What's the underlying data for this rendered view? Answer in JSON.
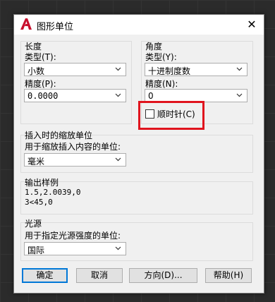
{
  "dialog": {
    "title": "图形单位",
    "close_glyph": "✕"
  },
  "length": {
    "group_label": "长度",
    "type_label": "类型(T):",
    "type_value": "小数",
    "precision_label": "精度(P):",
    "precision_value": "0.0000"
  },
  "angle": {
    "group_label": "角度",
    "type_label": "类型(Y):",
    "type_value": "十进制度数",
    "precision_label": "精度(N):",
    "precision_value": "0",
    "clockwise_label": "顺时针(C)",
    "clockwise_checked": false
  },
  "insertion": {
    "group_label": "插入时的缩放单位",
    "units_label": "用于缩放插入内容的单位:",
    "units_value": "毫米"
  },
  "sample": {
    "group_label": "输出样例",
    "line1": "1.5,2.0039,0",
    "line2": "3<45,0"
  },
  "lighting": {
    "group_label": "光源",
    "units_label": "用于指定光源强度的单位:",
    "units_value": "国际"
  },
  "buttons": {
    "ok": "确定",
    "cancel": "取消",
    "direction": "方向(D)...",
    "help": "帮助(H)"
  },
  "colors": {
    "highlight": "#e0141e",
    "app_icon": "#c8102e"
  }
}
